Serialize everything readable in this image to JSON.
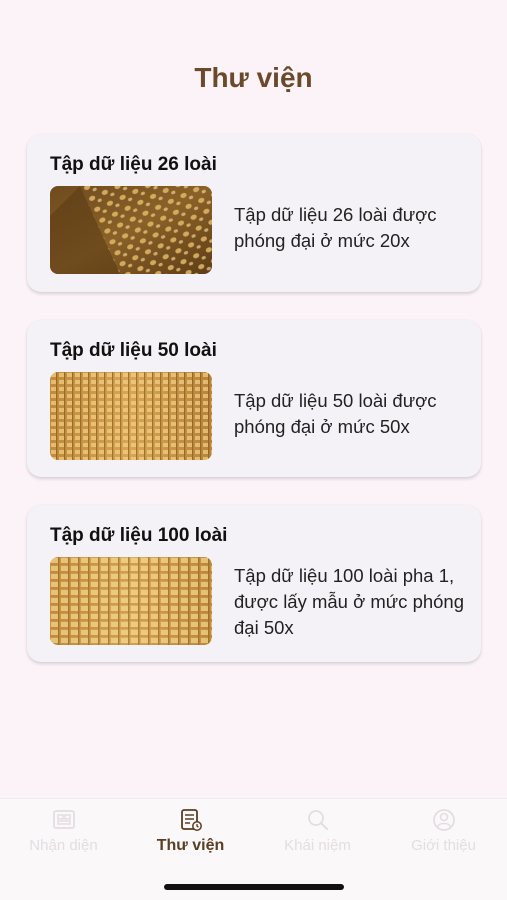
{
  "page": {
    "title": "Thư viện"
  },
  "cards": [
    {
      "title": "Tập dữ liệu 26 loài",
      "description": "Tập dữ liệu 26 loài được phóng đại ở mức 20x"
    },
    {
      "title": "Tập dữ liệu 50 loài",
      "description": "Tập dữ liệu 50 loài được phóng đại ở mức 50x"
    },
    {
      "title": "Tập dữ liệu 100 loài",
      "description": "Tập dữ liệu 100 loài pha 1, được lấy mẫu ở mức phóng đại 50x"
    }
  ],
  "tabbar": {
    "items": [
      {
        "label": "Nhận diện",
        "icon": "scan-icon"
      },
      {
        "label": "Thư viện",
        "icon": "library-icon",
        "active": true
      },
      {
        "label": "Khái niệm",
        "icon": "search-icon"
      },
      {
        "label": "Giới thiệu",
        "icon": "profile-icon"
      }
    ]
  },
  "colors": {
    "background": "#fbf3f8",
    "title_brown": "#6b4a2b",
    "card_bg": "#f5f2f7",
    "active_tab": "#5b3d22",
    "inactive_tab": "#e4dde2"
  }
}
